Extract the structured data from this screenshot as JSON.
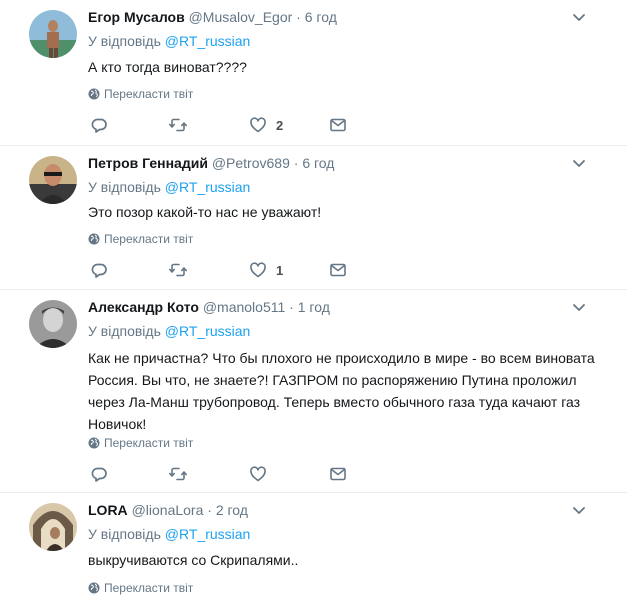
{
  "reply_prefix": "У відповідь",
  "translate_label": "Перекласти твіт",
  "tweets": [
    {
      "name": "Егор Мусалов",
      "handle": "@Musalov_Egor",
      "time": "6 год",
      "reply_to": "@RT_russian",
      "text": "А кто тогда виноват????",
      "likes": "2",
      "avatar_icon": "avatar-person-beach"
    },
    {
      "name": "Петров Геннадий",
      "handle": "@Petrov689",
      "time": "6 год",
      "reply_to": "@RT_russian",
      "text": "Это позор какой-то нас не уважают!",
      "likes": "1",
      "avatar_icon": "avatar-person-sunglasses"
    },
    {
      "name": "Александр Кото",
      "handle": "@manolo511",
      "time": "1 год",
      "reply_to": "@RT_russian",
      "text": "Как не причастна? Что бы плохого не происходило в мире - во всем виновата Россия. Вы что, не знаете?! ГАЗПРОМ по распоряжению Путина проложил через Ла-Манш трубопровод. Теперь  вместо обычного газа туда качают газ Новичок!",
      "likes": "",
      "avatar_icon": "avatar-person-bw-portrait"
    },
    {
      "name": "LORA",
      "handle": "@lionaLora",
      "time": "2 год",
      "reply_to": "@RT_russian",
      "text": "выкручиваются со Скрипалями..",
      "likes": "",
      "avatar_icon": "avatar-person-arch"
    }
  ]
}
